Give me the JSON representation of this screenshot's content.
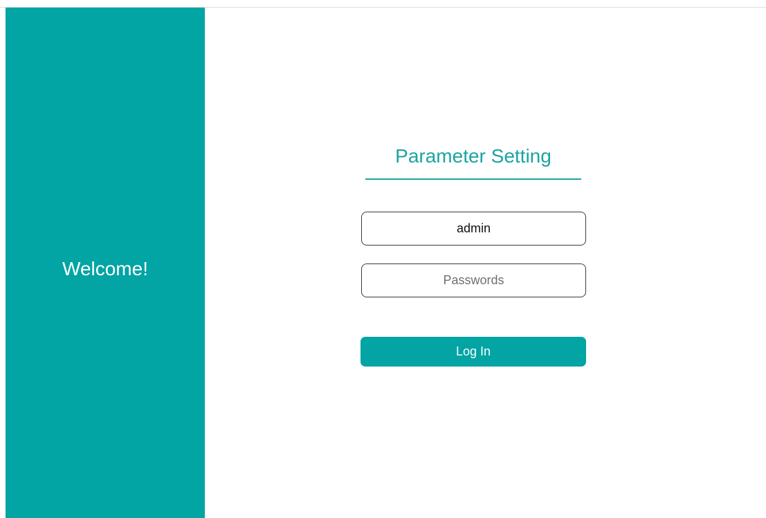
{
  "sidebar": {
    "welcome_text": "Welcome!"
  },
  "login_form": {
    "title": "Parameter Setting",
    "username": {
      "value": "admin",
      "placeholder": ""
    },
    "password": {
      "value": "",
      "placeholder": "Passwords"
    },
    "login_label": "Log In"
  },
  "colors": {
    "accent": "#02a4a4",
    "title": "#1ba3a3",
    "background": "#ffffff"
  }
}
